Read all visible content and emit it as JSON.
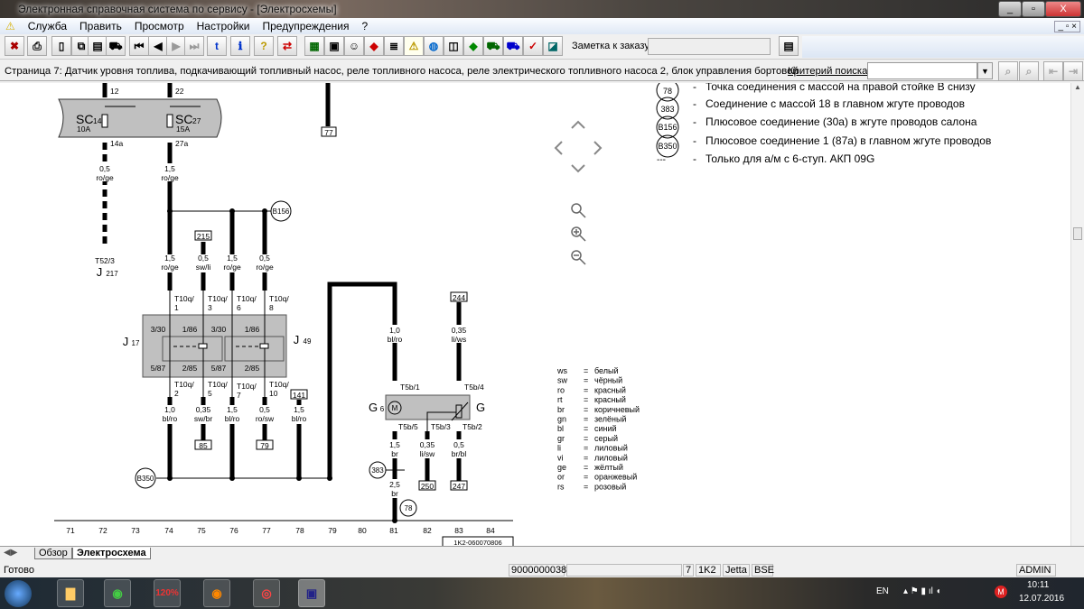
{
  "window": {
    "title": "Электронная справочная система по сервису - [Электросхемы]",
    "min": "_",
    "max": "▫",
    "close": "X"
  },
  "menu": [
    "Служба",
    "Править",
    "Просмотр",
    "Настройки",
    "Предупреждения",
    "?"
  ],
  "toolbar": {
    "order_note_label": "Заметка к заказу:",
    "order_note_value": ""
  },
  "page": {
    "title": "Страница 7: Датчик уровня топлива, подкачивающий топливный насос, реле топливного насоса, реле электрического топливного насоса 2, блок управления бортовой",
    "search_label": "Критерий поиска:",
    "search_value": ""
  },
  "diagram": {
    "fuse1": {
      "name": "SC",
      "sub": "14",
      "amp": "10A",
      "in": "12",
      "out": "14a"
    },
    "fuse2": {
      "name": "SC",
      "sub": "27",
      "amp": "15A",
      "in": "22",
      "out": "27a"
    },
    "wires": {
      "w1": [
        "0,5",
        "ro/ge"
      ],
      "w2": [
        "1,5",
        "ro/ge"
      ],
      "w3": [
        "1,5",
        "ro/ge"
      ],
      "w4": [
        "0,5",
        "sw/li"
      ],
      "w5": [
        "1,5",
        "ro/ge"
      ],
      "w6": [
        "0,5",
        "ro/ge"
      ],
      "w7": [
        "1,0",
        "bl/ro"
      ],
      "w8": [
        "0,35",
        "sw/br"
      ],
      "w9": [
        "1,5",
        "bl/ro"
      ],
      "w10": [
        "0,5",
        "ro/sw"
      ],
      "w11": [
        "1,5",
        "bl/ro"
      ],
      "w12": [
        "1,0",
        "bl/ro"
      ],
      "w13": [
        "0,35",
        "li/ws"
      ],
      "w14": [
        "1,5",
        "br"
      ],
      "w15": [
        "0,35",
        "li/sw"
      ],
      "w16": [
        "0,5",
        "br/bl"
      ],
      "w17": [
        "2,5",
        "br"
      ]
    },
    "connector_j217": "T52/3",
    "j217": "J",
    "j217_sub": "217",
    "refs": {
      "r77": "77",
      "r215": "215",
      "r85": "85",
      "r79": "79",
      "r141": "141",
      "r244": "244",
      "r250": "250",
      "r247": "247"
    },
    "circles": {
      "b156": "B156",
      "b350": "B350",
      "c383": "383",
      "c78": "78"
    },
    "relay": {
      "j17": "J",
      "j17_sub": "17",
      "j49": "J",
      "j49_sub": "49",
      "p1": "3/30",
      "p2": "1/86",
      "p3": "3/30",
      "p4": "1/86",
      "p5": "5/87",
      "p6": "2/85",
      "p7": "5/87",
      "p8": "2/85",
      "t1": "T10q/",
      "t1n": "1",
      "t3n": "3",
      "t6n": "6",
      "t8n": "8",
      "t2n": "2",
      "t5n": "5",
      "t7n": "7",
      "t10n": "10"
    },
    "sender": {
      "g6": "G",
      "g6_sub": "6",
      "g": "G",
      "t1": "T5b/1",
      "t4": "T5b/4",
      "t5": "T5b/5",
      "t3": "T5b/3",
      "t2": "T5b/2"
    },
    "grid": [
      "71",
      "72",
      "73",
      "74",
      "75",
      "76",
      "77",
      "78",
      "79",
      "80",
      "81",
      "82",
      "83",
      "84"
    ],
    "doc_id": "1K2-060070806"
  },
  "legend": [
    {
      "sym": "78",
      "text": "Точка соединения с массой на правой стойке B снизу"
    },
    {
      "sym": "383",
      "text": "Соединение с массой 18 в главном жгуте проводов"
    },
    {
      "sym": "B156",
      "text": "Плюсовое соединение (30а) в жгуте проводов салона"
    },
    {
      "sym": "B350",
      "text": "Плюсовое соединение 1 (87а) в главном жгуте проводов"
    },
    {
      "sym": "---",
      "text": "Только для а/м с 6-ступ. АКП 09G"
    }
  ],
  "colors": [
    [
      "ws",
      "белый"
    ],
    [
      "sw",
      "чёрный"
    ],
    [
      "ro",
      "красный"
    ],
    [
      "rt",
      "красный"
    ],
    [
      "br",
      "коричневый"
    ],
    [
      "gn",
      "зелёный"
    ],
    [
      "bl",
      "синий"
    ],
    [
      "gr",
      "серый"
    ],
    [
      "li",
      "лиловый"
    ],
    [
      "vi",
      "лиловый"
    ],
    [
      "ge",
      "жёлтый"
    ],
    [
      "or",
      "оранжевый"
    ],
    [
      "rs",
      "розовый"
    ]
  ],
  "tabs": [
    "Обзор",
    "Электросхема"
  ],
  "status": {
    "ready": "Готово",
    "code": "9000000038",
    "page": "7",
    "model_code": "1K2",
    "model": "Jetta",
    "engine": "BSE",
    "user": "ADMIN"
  },
  "taskbar": {
    "lang": "EN",
    "time": "10:11",
    "date": "12.07.2016",
    "app_120": "120%"
  }
}
